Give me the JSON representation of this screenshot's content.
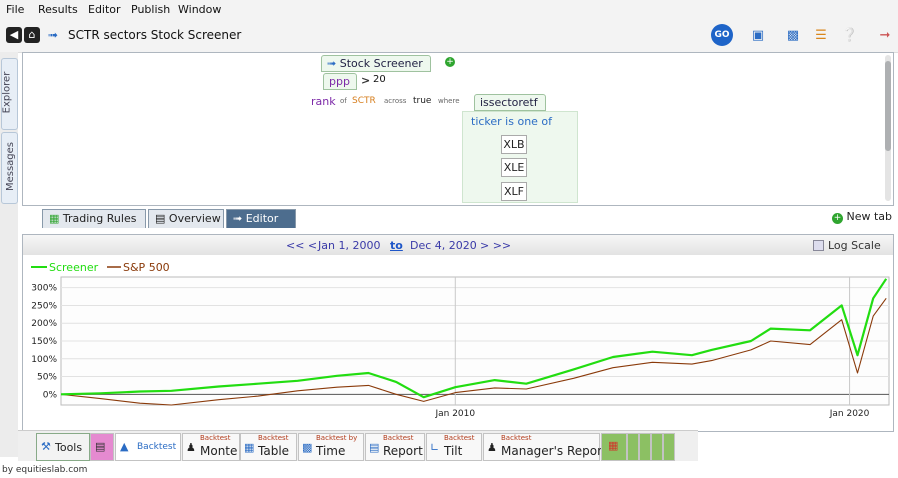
{
  "menu": [
    "File",
    "Results",
    "Editor",
    "Publish",
    "Window"
  ],
  "toolbar": {
    "title": "SCTR sectors Stock Screener",
    "go_label": "GO"
  },
  "side_tabs": {
    "explorer": "Explorer",
    "messages": "Messages"
  },
  "editor": {
    "screener_tab": "Stock Screener",
    "field": "ppp",
    "operator": ">",
    "threshold": "20",
    "rank": "rank",
    "of": "of",
    "sctr": "SCTR",
    "across": "across",
    "true": "true",
    "where": "where",
    "issector": "issectoretf",
    "ticker_rule": "ticker is one of",
    "tickers": [
      "XLB",
      "XLE",
      "XLF"
    ]
  },
  "bottom_tabs": {
    "trading_rules": "Trading Rules",
    "overview": "Overview",
    "editor": "Editor",
    "new_tab": "New tab"
  },
  "chart_header": {
    "prev": "<< <",
    "start": "Jan 1, 2000",
    "to": "to",
    "end": "Dec 4, 2020",
    "next": "> >>",
    "log_scale": "Log Scale"
  },
  "colors": {
    "screener": "#22dd11",
    "sp500": "#8a3a0a",
    "accent": "#2b6cc4"
  },
  "chart_data": {
    "type": "line",
    "xlabel": "",
    "ylabel": "",
    "x_ticks": [
      "Jan 2010",
      "Jan 2020"
    ],
    "y_ticks": [
      "300%",
      "250%",
      "200%",
      "150%",
      "100%",
      "50%",
      "0%"
    ],
    "ylim": [
      -30,
      330
    ],
    "series": [
      {
        "name": "Screener",
        "values": [
          [
            2000.0,
            0
          ],
          [
            2001.0,
            3
          ],
          [
            2002.0,
            8
          ],
          [
            2002.8,
            10
          ],
          [
            2004.0,
            22
          ],
          [
            2005.0,
            30
          ],
          [
            2006.0,
            38
          ],
          [
            2007.0,
            52
          ],
          [
            2007.8,
            60
          ],
          [
            2008.5,
            35
          ],
          [
            2009.2,
            -8
          ],
          [
            2010.0,
            20
          ],
          [
            2011.0,
            40
          ],
          [
            2011.8,
            30
          ],
          [
            2013.0,
            70
          ],
          [
            2014.0,
            105
          ],
          [
            2015.0,
            120
          ],
          [
            2016.0,
            110
          ],
          [
            2016.5,
            125
          ],
          [
            2017.5,
            150
          ],
          [
            2018.0,
            185
          ],
          [
            2019.0,
            180
          ],
          [
            2019.8,
            250
          ],
          [
            2020.2,
            110
          ],
          [
            2020.6,
            270
          ],
          [
            2020.93,
            325
          ]
        ]
      },
      {
        "name": "S&P 500",
        "values": [
          [
            2000.0,
            0
          ],
          [
            2001.0,
            -12
          ],
          [
            2002.0,
            -25
          ],
          [
            2002.8,
            -30
          ],
          [
            2004.0,
            -15
          ],
          [
            2005.0,
            -5
          ],
          [
            2006.0,
            10
          ],
          [
            2007.0,
            20
          ],
          [
            2007.8,
            25
          ],
          [
            2008.5,
            0
          ],
          [
            2009.2,
            -20
          ],
          [
            2010.0,
            5
          ],
          [
            2011.0,
            18
          ],
          [
            2011.8,
            15
          ],
          [
            2013.0,
            45
          ],
          [
            2014.0,
            75
          ],
          [
            2015.0,
            90
          ],
          [
            2016.0,
            85
          ],
          [
            2016.5,
            95
          ],
          [
            2017.5,
            125
          ],
          [
            2018.0,
            150
          ],
          [
            2019.0,
            140
          ],
          [
            2019.8,
            210
          ],
          [
            2020.2,
            60
          ],
          [
            2020.6,
            220
          ],
          [
            2020.93,
            270
          ]
        ]
      }
    ]
  },
  "bottom_bar": {
    "tools": "Tools",
    "backtest": "Backtest",
    "backtest_small": "Backtest",
    "backtest_by": "Backtest by",
    "monte": "Monte",
    "table": "Table",
    "time": "Time",
    "report": "Report",
    "tilt": "Tilt",
    "managers_report": "Manager's Report"
  },
  "credit": "by equitieslab.com"
}
